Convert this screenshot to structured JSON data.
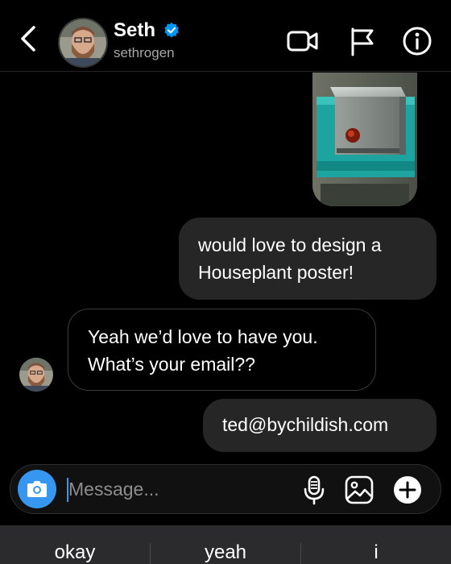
{
  "header": {
    "name": "Seth",
    "username": "sethrogen"
  },
  "messages": [
    {
      "direction": "outgoing",
      "text": "would love to design a Houseplant poster!"
    },
    {
      "direction": "incoming",
      "text": "Yeah we’d love to have you. What’s your email??"
    },
    {
      "direction": "outgoing",
      "text": "ted@bychildish.com"
    }
  ],
  "composer": {
    "placeholder": "Message..."
  },
  "suggestions": [
    "okay",
    "yeah",
    "i"
  ],
  "colors": {
    "background": "#000000",
    "outgoing_bubble": "#262626",
    "accent_blue": "#3797f0",
    "verified_blue": "#0095f6"
  },
  "icons": [
    "back-arrow-icon",
    "verified-badge-icon",
    "video-call-icon",
    "flag-icon",
    "info-icon",
    "camera-icon",
    "microphone-icon",
    "gallery-icon",
    "plus-icon"
  ]
}
